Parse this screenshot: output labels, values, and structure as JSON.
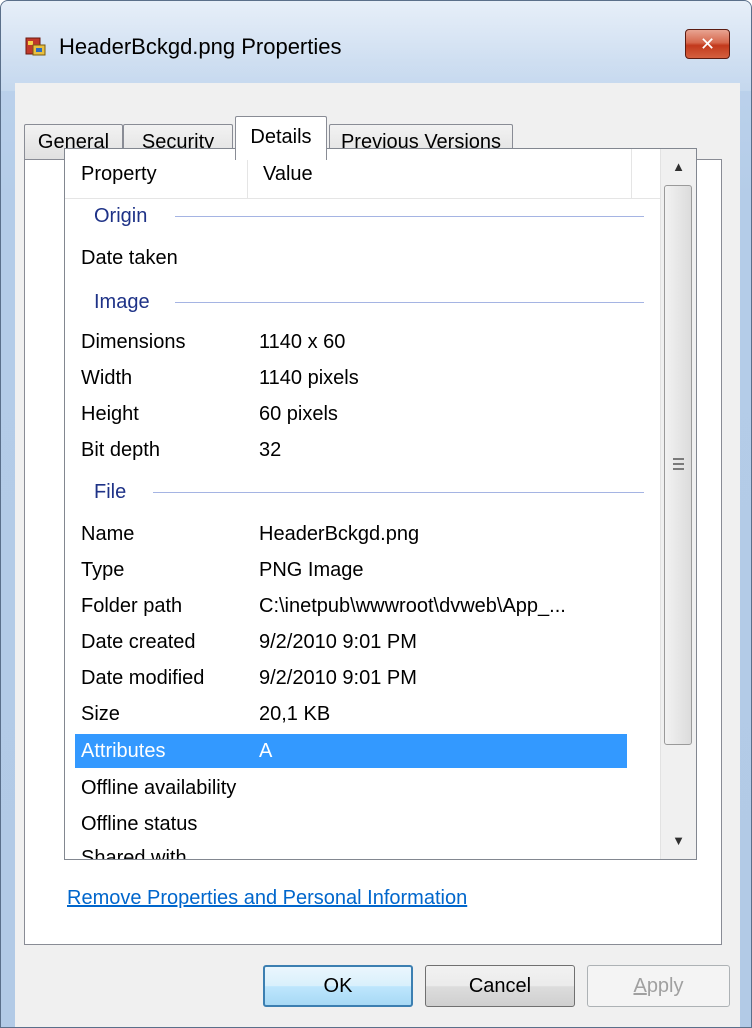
{
  "window": {
    "title": "HeaderBckgd.png Properties",
    "close_glyph": "✕"
  },
  "tabs": [
    {
      "label": "General",
      "active": false
    },
    {
      "label": "Security",
      "active": false
    },
    {
      "label": "Details",
      "active": true
    },
    {
      "label": "Previous Versions",
      "active": false
    }
  ],
  "list": {
    "header": {
      "property": "Property",
      "value": "Value"
    },
    "groups": {
      "origin": "Origin",
      "image": "Image",
      "file": "File"
    },
    "rows": {
      "date_taken": {
        "name": "Date taken",
        "value": ""
      },
      "dimensions": {
        "name": "Dimensions",
        "value": "1140 x 60"
      },
      "width": {
        "name": "Width",
        "value": "1140 pixels"
      },
      "height": {
        "name": "Height",
        "value": "60 pixels"
      },
      "bit_depth": {
        "name": "Bit depth",
        "value": "32"
      },
      "name": {
        "name": "Name",
        "value": "HeaderBckgd.png"
      },
      "type": {
        "name": "Type",
        "value": "PNG Image"
      },
      "folder_path": {
        "name": "Folder path",
        "value": "C:\\inetpub\\wwwroot\\dvweb\\App_..."
      },
      "date_created": {
        "name": "Date created",
        "value": "9/2/2010 9:01 PM"
      },
      "date_modified": {
        "name": "Date modified",
        "value": "9/2/2010 9:01 PM"
      },
      "size": {
        "name": "Size",
        "value": "20,1 KB"
      },
      "attributes": {
        "name": "Attributes",
        "value": "A",
        "selected": true
      },
      "offline_availability": {
        "name": "Offline availability",
        "value": ""
      },
      "offline_status": {
        "name": "Offline status",
        "value": ""
      },
      "shared_with": {
        "name": "Shared with",
        "value": ""
      }
    }
  },
  "link": {
    "remove_properties": "Remove Properties and Personal Information"
  },
  "buttons": {
    "ok": "OK",
    "cancel": "Cancel",
    "apply_accel": "A",
    "apply_rest": "pply"
  },
  "icons": {
    "app": "image-file-icon",
    "close": "close-icon",
    "scroll_up": "scroll-up-arrow-icon",
    "scroll_down": "scroll-down-arrow-icon",
    "scroll_grip": "scroll-grip-icon"
  },
  "colors": {
    "selection": "#3399ff",
    "group_text": "#1e3287",
    "link": "#0066cc"
  }
}
